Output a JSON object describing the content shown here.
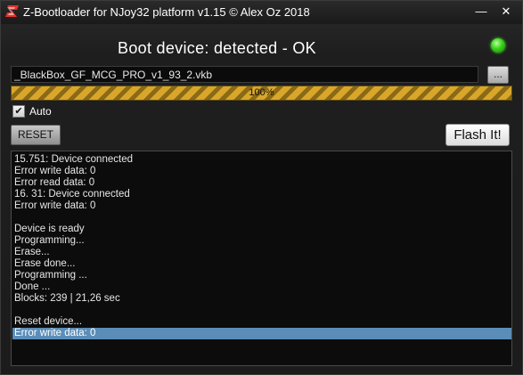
{
  "window": {
    "title": "Z-Bootloader for NJoy32 platform v1.15 © Alex Oz 2018",
    "minimize_glyph": "—",
    "close_glyph": "✕"
  },
  "status": {
    "text": "Boot device: detected - OK",
    "led_color": "#39d11a"
  },
  "file": {
    "value": "_BlackBox_GF_MCG_PRO_v1_93_2.vkb",
    "browse_label": "..."
  },
  "progress": {
    "value": 1.0,
    "label": "100%"
  },
  "auto": {
    "checked": true,
    "check_glyph": "✔",
    "label": "Auto"
  },
  "buttons": {
    "reset": "RESET",
    "flash": "Flash It!"
  },
  "log": {
    "lines": [
      "15.751: Device connected",
      "Error write data: 0",
      "Error read data: 0",
      "16. 31: Device connected",
      "Error write data: 0",
      "",
      "Device is ready",
      "Programming...",
      "Erase...",
      "Erase done...",
      "Programming ...",
      "Done ...",
      "Blocks: 239  |  21,26 sec",
      "",
      "Reset device...",
      "Error write data: 0"
    ],
    "selected_index": 15
  }
}
